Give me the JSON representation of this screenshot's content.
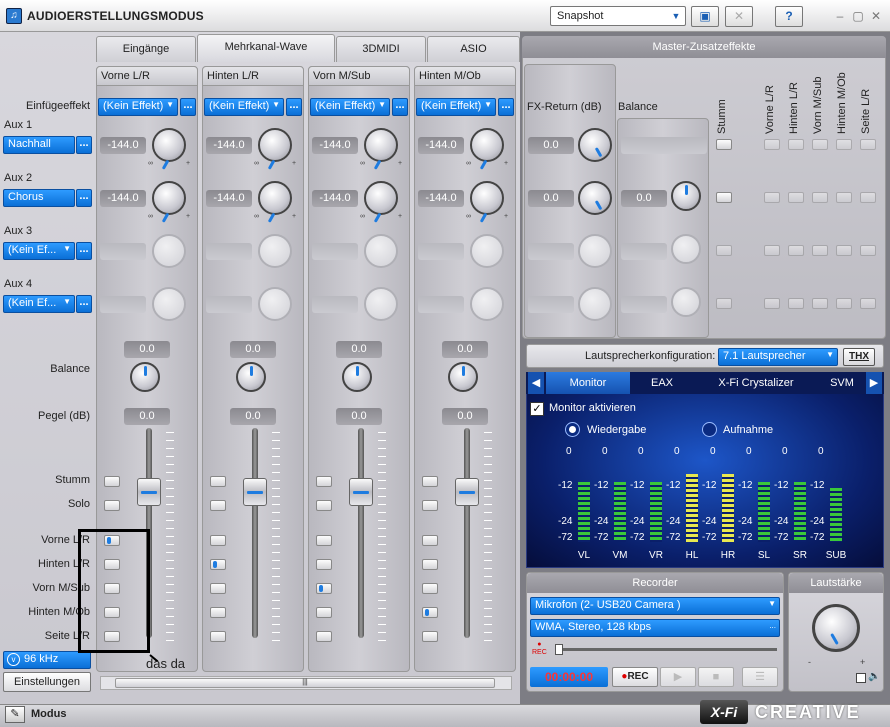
{
  "window": {
    "title": "AUDIOERSTELLUNGSMODUS",
    "snapshot": "Snapshot",
    "help": "?"
  },
  "tabs": [
    "Eingänge",
    "Mehrkanal-Wave",
    "3DMIDI",
    "ASIO"
  ],
  "left_labels": {
    "einfuege": "Einfügeeffekt",
    "aux1": "Aux 1",
    "aux2": "Aux 2",
    "aux3": "Aux 3",
    "aux4": "Aux 4",
    "balance": "Balance",
    "pegel": "Pegel (dB)",
    "stumm": "Stumm",
    "solo": "Solo",
    "vorne": "Vorne L/R",
    "hinten": "Hinten L/R",
    "vornmsub": "Vorn M/Sub",
    "hintenmob": "Hinten M/Ob",
    "seite": "Seite L/R"
  },
  "aux_buttons": {
    "aux1": "Nachhall",
    "aux2": "Chorus",
    "aux3": "(Kein Ef...",
    "aux4": "(Kein Ef..."
  },
  "channels": [
    {
      "name": "Vorne L/R",
      "effect": "(Kein Effekt)",
      "aux1": "-144.0",
      "aux2": "-144.0",
      "balance": "0.0",
      "pegel": "0.0"
    },
    {
      "name": "Hinten L/R",
      "effect": "(Kein Effekt)",
      "aux1": "-144.0",
      "aux2": "-144.0",
      "balance": "0.0",
      "pegel": "0.0"
    },
    {
      "name": "Vorn M/Sub",
      "effect": "(Kein Effekt)",
      "aux1": "-144.0",
      "aux2": "-144.0",
      "balance": "0.0",
      "pegel": "0.0"
    },
    {
      "name": "Hinten M/Ob",
      "effect": "(Kein Effekt)",
      "aux1": "-144.0",
      "aux2": "-144.0",
      "balance": "0.0",
      "pegel": "0.0"
    }
  ],
  "knob_marks": {
    "inf": "∞",
    "plus": "+",
    "zero": "0"
  },
  "sample_rate": "96 kHz",
  "einstellungen": "Einstellungen",
  "annotation": "das da",
  "master": {
    "title": "Master-Zusatzeffekte",
    "fx_return": "FX-Return (dB)",
    "balance": "Balance",
    "fx1": "0.0",
    "fx2": "0.0",
    "bal": "0.0",
    "cols": [
      "Stumm",
      "Vorne L/R",
      "Hinten L/R",
      "Vorn M/Sub",
      "Hinten M/Ob",
      "Seite L/R"
    ]
  },
  "speaker": {
    "label": "Lautsprecherkonfiguration:",
    "value": "7.1 Lautsprecher",
    "thx": "THX"
  },
  "monitor": {
    "tabs": [
      "Monitor",
      "EAX",
      "X-Fi Crystalizer",
      "SVM"
    ],
    "check": "Monitor aktivieren",
    "radio1": "Wiedergabe",
    "radio2": "Aufnahme",
    "meters": [
      "VL",
      "VM",
      "VR",
      "HL",
      "HR",
      "SL",
      "SR",
      "SUB"
    ],
    "scale": [
      "0",
      "-12",
      "-24",
      "-72"
    ]
  },
  "recorder": {
    "title": "Recorder",
    "source": "Mikrofon (2- USB20 Camera   )",
    "format": "WMA, Stereo, 128 kbps",
    "rec_small": "REC",
    "time": "00:00:00",
    "rec": "REC"
  },
  "volume": {
    "title": "Lautstärke"
  },
  "bottom": {
    "mode": "Modus",
    "brand1": "X-Fi",
    "brand2": "CREATIVE"
  },
  "colors": {
    "accent": "#0a7ae6",
    "meter_green": "#3ac83a",
    "meter_peak": "#e8e850"
  }
}
